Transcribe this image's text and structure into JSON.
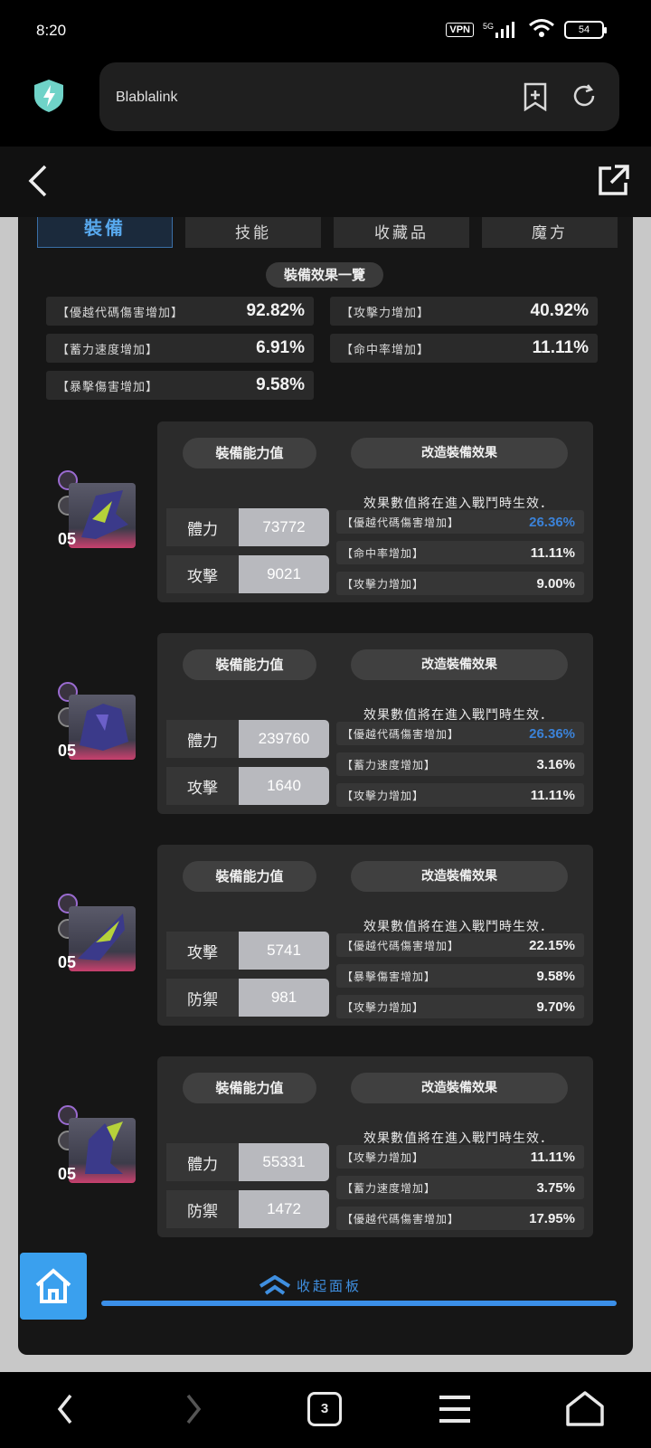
{
  "status_bar": {
    "time": "8:20",
    "vpn": "VPN",
    "network": "5G",
    "battery": "54"
  },
  "browser": {
    "url_title": "Blablalink",
    "add_bookmark_icon": "add-bookmark-icon",
    "reload_icon": "reload-icon"
  },
  "tabs": [
    {
      "label": "裝備",
      "active": true
    },
    {
      "label": "技能",
      "active": false
    },
    {
      "label": "收藏品",
      "active": false
    },
    {
      "label": "魔方",
      "active": false
    }
  ],
  "summary": {
    "title": "裝備效果一覽",
    "items": [
      {
        "label": "【優越代碼傷害增加】",
        "value": "92.82%"
      },
      {
        "label": "【攻擊力增加】",
        "value": "40.92%"
      },
      {
        "label": "【蓄力速度增加】",
        "value": "6.91%"
      },
      {
        "label": "【命中率增加】",
        "value": "11.11%"
      },
      {
        "label": "【暴擊傷害增加】",
        "value": "9.58%"
      }
    ]
  },
  "card_labels": {
    "ability": "裝備能力值",
    "mod_effect": "改造裝備效果",
    "note": "效果數值將在進入戰鬥時生效．"
  },
  "equipment": [
    {
      "level": "05",
      "stats": [
        {
          "label": "體力",
          "value": "73772"
        },
        {
          "label": "攻擊",
          "value": "9021"
        }
      ],
      "effects": [
        {
          "label": "【優越代碼傷害增加】",
          "value": "26.36%",
          "highlight": true
        },
        {
          "label": "【命中率增加】",
          "value": "11.11%",
          "highlight": false
        },
        {
          "label": "【攻擊力增加】",
          "value": "9.00%",
          "highlight": false
        }
      ]
    },
    {
      "level": "05",
      "stats": [
        {
          "label": "體力",
          "value": "239760"
        },
        {
          "label": "攻擊",
          "value": "1640"
        }
      ],
      "effects": [
        {
          "label": "【優越代碼傷害增加】",
          "value": "26.36%",
          "highlight": true
        },
        {
          "label": "【蓄力速度增加】",
          "value": "3.16%",
          "highlight": false
        },
        {
          "label": "【攻擊力增加】",
          "value": "11.11%",
          "highlight": false
        }
      ]
    },
    {
      "level": "05",
      "stats": [
        {
          "label": "攻擊",
          "value": "5741"
        },
        {
          "label": "防禦",
          "value": "981"
        }
      ],
      "effects": [
        {
          "label": "【優越代碼傷害增加】",
          "value": "22.15%",
          "highlight": false
        },
        {
          "label": "【暴擊傷害增加】",
          "value": "9.58%",
          "highlight": false
        },
        {
          "label": "【攻擊力增加】",
          "value": "9.70%",
          "highlight": false
        }
      ]
    },
    {
      "level": "05",
      "stats": [
        {
          "label": "體力",
          "value": "55331"
        },
        {
          "label": "防禦",
          "value": "1472"
        }
      ],
      "effects": [
        {
          "label": "【攻擊力增加】",
          "value": "11.11%",
          "highlight": false
        },
        {
          "label": "【蓄力速度增加】",
          "value": "3.75%",
          "highlight": false
        },
        {
          "label": "【優越代碼傷害增加】",
          "value": "17.95%",
          "highlight": false
        }
      ]
    }
  ],
  "collapse_label": "收起面板",
  "bottom_nav": {
    "tab_count": "3"
  },
  "colors": {
    "accent_blue": "#3b82d8",
    "home_button": "#3aa0ee",
    "collapse_bar": "#3b8fe8"
  }
}
